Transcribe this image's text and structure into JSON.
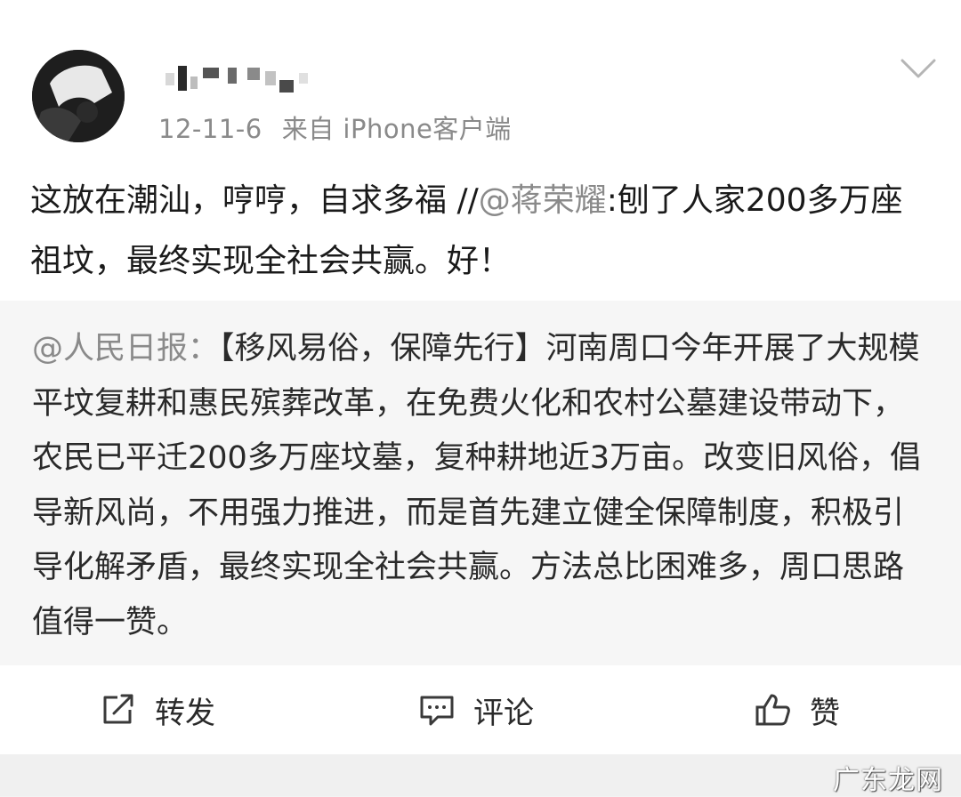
{
  "post": {
    "date": "12-11-6",
    "source": "来自 iPhone客户端",
    "text_main": "这放在潮汕，哼哼，自求多福 //",
    "mention": "@蒋荣耀",
    "text_after_mention": ":刨了人家200多万座祖坟，最终实现全社会共赢。好！"
  },
  "quoted": {
    "author": "@人民日报：",
    "text": "【移风易俗，保障先行】河南周口今年开展了大规模平坟复耕和惠民殡葬改革，在免费火化和农村公墓建设带动下，农民已平迁200多万座坟墓，复种耕地近3万亩。改变旧风俗，倡导新风尚，不用强力推进，而是首先建立健全保障制度，积极引导化解矛盾，最终实现全社会共赢。方法总比困难多，周口思路值得一赞。"
  },
  "actions": {
    "repost": "转发",
    "comment": "评论",
    "like": "赞"
  },
  "icons": {
    "menu": "chevron-down-icon",
    "repost": "share-icon",
    "comment": "comment-icon",
    "like": "thumbs-up-icon"
  },
  "watermark": "广东龙网",
  "colors": {
    "text": "#1a1a1a",
    "muted": "#8a8a8a",
    "quote_bg": "#f6f6f6"
  }
}
